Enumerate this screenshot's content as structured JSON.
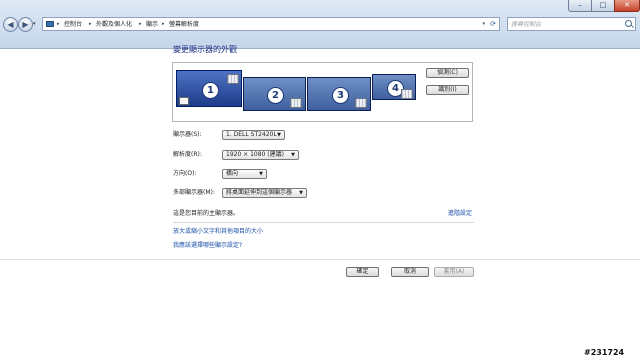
{
  "window": {
    "minimize_glyph": "–",
    "maximize_glyph": "□",
    "close_glyph": "✕"
  },
  "nav": {
    "back_glyph": "◀",
    "forward_glyph": "▶",
    "recent_glyph": "▾"
  },
  "breadcrumb": {
    "items": [
      "控制台",
      "外觀及個人化",
      "顯示",
      "螢幕解析度"
    ],
    "separator": "▸"
  },
  "search": {
    "placeholder": "搜尋控制台"
  },
  "page": {
    "title": "變更顯示器的外觀"
  },
  "monitors": [
    "1",
    "2",
    "3",
    "4"
  ],
  "buttons": {
    "detect": "偵測(C)",
    "identify": "識別(I)",
    "ok": "確定",
    "cancel": "取消",
    "apply": "套用(A)"
  },
  "settings": {
    "display_label": "顯示器(S):",
    "display_value": "1. DELL ST2420L",
    "resolution_label": "解析度(R):",
    "resolution_value": "1920 × 1080 (建議)",
    "orientation_label": "方向(O):",
    "orientation_value": "橫向",
    "multi_label": "多部顯示器(M):",
    "multi_value": "將桌面延伸到這個顯示器"
  },
  "primary_text": "這是您目前的主顯示器。",
  "advanced_link": "進階設定",
  "links": {
    "text_size": "放大或縮小文字和其他項目的大小",
    "help": "我應該選擇哪些顯示設定?"
  },
  "watermark": "#231724",
  "colors": {
    "title": "#1e3287",
    "link": "#1c4fa8"
  }
}
